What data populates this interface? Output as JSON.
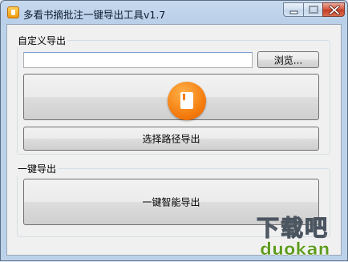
{
  "window": {
    "title": "多看书摘批注一键导出工具v1.7",
    "controls": {
      "minimize": "minimize",
      "maximize": "maximize",
      "close": "close"
    }
  },
  "custom_export": {
    "legend": "自定义导出",
    "path_input": {
      "value": "",
      "placeholder": ""
    },
    "browse_label": "浏览...",
    "select_path_export_label": "选择路径导出",
    "icon": "book-icon",
    "accent_color": "#f47a0c"
  },
  "one_click_export": {
    "legend": "一键导出",
    "smart_export_label": "一键智能导出"
  },
  "watermark": {
    "top_text": "下载吧",
    "bottom_text": "duokan"
  }
}
